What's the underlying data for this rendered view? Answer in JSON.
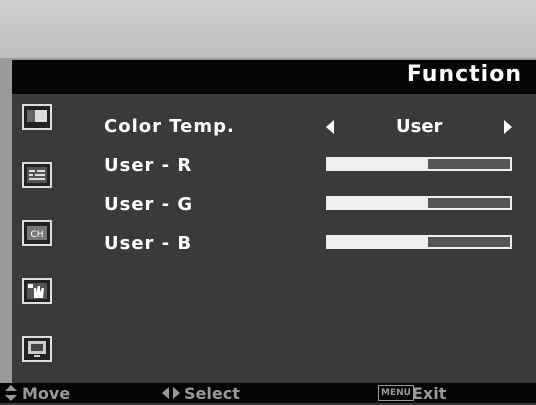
{
  "header": {
    "title": "Function"
  },
  "sidebar": {
    "items": [
      {
        "icon": "picture-icon"
      },
      {
        "icon": "position-icon"
      },
      {
        "icon": "ch-icon"
      },
      {
        "icon": "hand-icon"
      },
      {
        "icon": "monitor-icon"
      }
    ]
  },
  "settings": {
    "color_temp": {
      "label": "Color Temp.",
      "value": "User"
    },
    "user_r": {
      "label": "User  -  R",
      "level": 0.55
    },
    "user_g": {
      "label": "User  -  G",
      "level": 0.55
    },
    "user_b": {
      "label": "User  -  B",
      "level": 0.55
    }
  },
  "footer": {
    "move_label": "Move",
    "select_label": "Select",
    "menu_icon_label": "MENU",
    "exit_label": "Exit"
  }
}
